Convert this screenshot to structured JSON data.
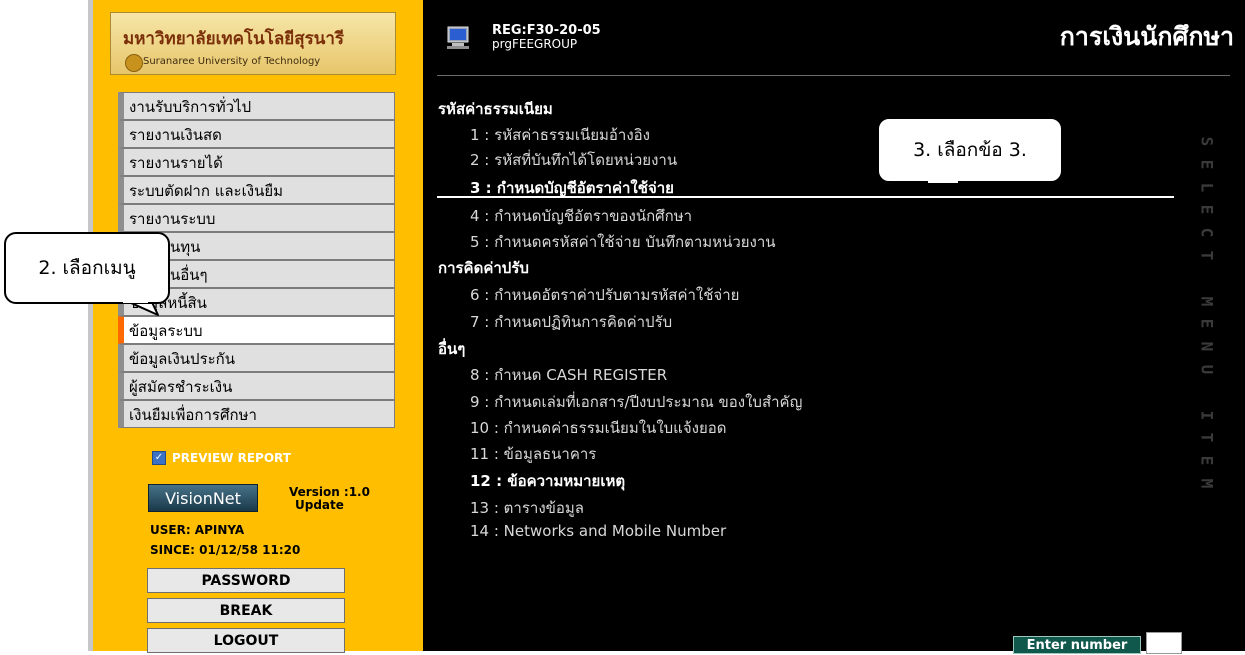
{
  "sidebar": {
    "logo": {
      "title_th": "มหาวิทยาลัยเทคโนโลยีสุรนารี",
      "title_en": "Suranaree University of Technology"
    },
    "menu": [
      {
        "label": "งานรับบริการทั่วไป"
      },
      {
        "label": "รายงานเงินสด"
      },
      {
        "label": "รายงานรายได้"
      },
      {
        "label": "ระบบตัดฝาก และเงินยืม"
      },
      {
        "label": "รายงานระบบ"
      },
      {
        "label": "รายงานทุน"
      },
      {
        "label": "รายงานอื่นๆ"
      },
      {
        "label": "ข้อมูลหนี้สิน"
      },
      {
        "label": "ข้อมูลระบบ",
        "active": true
      },
      {
        "label": "ข้อมูลเงินประกัน"
      },
      {
        "label": "ผู้สมัครชำระเงิน"
      },
      {
        "label": "เงินยืมเพื่อการศึกษา"
      }
    ],
    "preview_report": {
      "label": "PREVIEW REPORT",
      "checked": true
    },
    "visionnet_logo": "VisionNet",
    "version": {
      "line1": "Version :1.0",
      "line2": "Update"
    },
    "user": "USER: APINYA",
    "since": "SINCE: 01/12/58 11:20",
    "buttons": {
      "password": "PASSWORD",
      "break": "BREAK",
      "logout": "LOGOUT"
    }
  },
  "header": {
    "icon": "computer-icon",
    "reg_code": "REG:F30-20-05",
    "program": "prgFEEGROUP",
    "title": "การเงินนักศึกษา"
  },
  "sections": [
    {
      "title": "รหัสค่าธรรมเนียม",
      "items": [
        {
          "text": "1 : รหัสค่าธรรมเนียมอ้างอิง"
        },
        {
          "text": "2 : รหัสที่บันทึกได้โดยหน่วยงาน"
        },
        {
          "text": "3 : กำหนดบัญชีอัตราค่าใช้จ่าย",
          "highlight": true
        },
        {
          "text": "4 : กำหนดบัญชีอัตราของนักศึกษา"
        },
        {
          "text": "5 : กำหนดครหัสค่าใช้จ่าย  บันทึกตามหน่วยงาน"
        }
      ]
    },
    {
      "title": "การคิดค่าปรับ",
      "items": [
        {
          "text": "6 : กำหนดอัตราค่าปรับตามรหัสค่าใช้จ่าย"
        },
        {
          "text": "7 : กำหนดปฏิทินการคิดค่าปรับ"
        }
      ]
    },
    {
      "title": "อื่นๆ",
      "items": [
        {
          "text": "8 : กำหนด  CASH REGISTER"
        },
        {
          "text": "9 : กำหนดเล่มที่เอกสาร/ปีงบประมาณ ของใบสำคัญ"
        },
        {
          "text": "10 : กำหนดค่าธรรมเนียมในใบแจ้งยอด"
        },
        {
          "text": "11 : ข้อมูลธนาคาร"
        },
        {
          "text": "12 : ข้อความหมายเหตุ",
          "bright": true
        },
        {
          "text": "13 : ตารางข้อมูล"
        },
        {
          "text": "14 : Networks and Mobile Number"
        }
      ]
    }
  ],
  "vertical_text": "SELECT MENU ITEM",
  "enter_number": {
    "label": "Enter number",
    "value": ""
  },
  "annotations": {
    "step2": "2. เลือกเมนู",
    "step3": "3. เลือกข้อ 3."
  }
}
